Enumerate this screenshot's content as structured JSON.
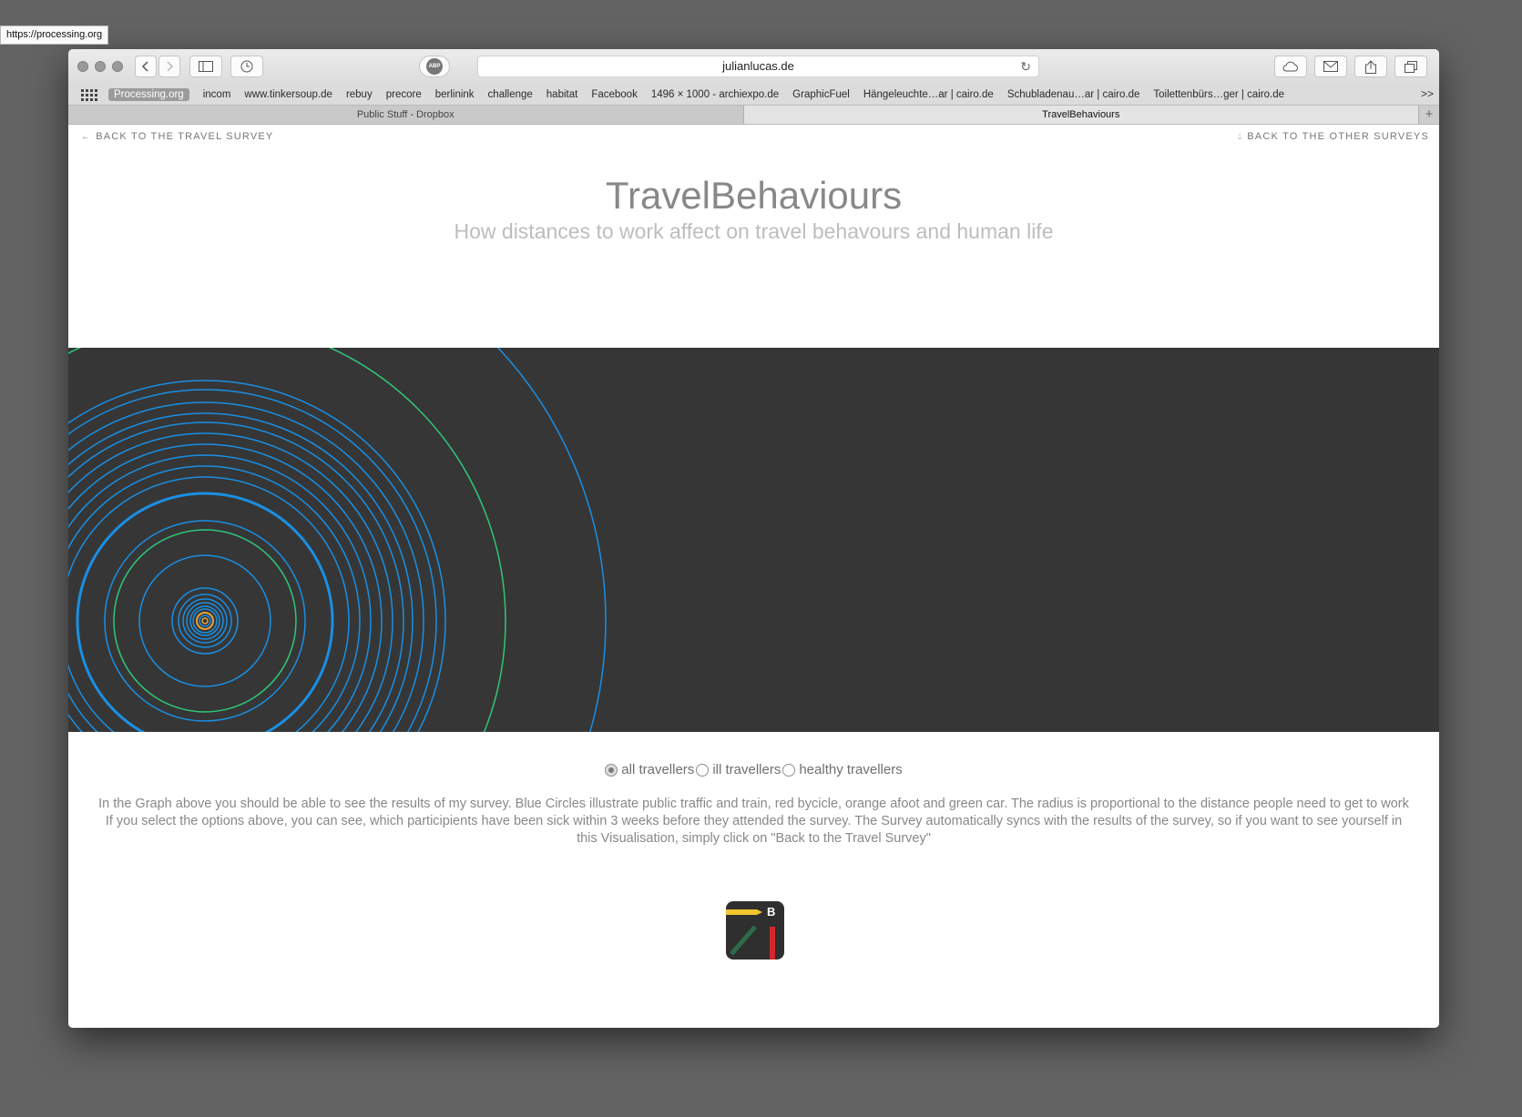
{
  "tooltip_url": "https://processing.org",
  "address_bar": {
    "host": "julianlucas.de"
  },
  "adblock_label": "ABP",
  "bookmarks": [
    "Processing.org",
    "incom",
    "www.tinkersoup.de",
    "rebuy",
    "precore",
    "berlinink",
    "challenge",
    "habitat",
    "Facebook",
    "1496 × 1000 - archiexpo.de",
    "GraphicFuel",
    "Hängeleuchte…ar | cairo.de",
    "Schubladenau…ar | cairo.de",
    "Toilettenbürs…ger | cairo.de"
  ],
  "bookmarks_more": ">>",
  "tabs": [
    {
      "label": "Public Stuff - Dropbox",
      "active": false
    },
    {
      "label": "TravelBehaviours",
      "active": true
    }
  ],
  "tab_add": "+",
  "nav": {
    "back_travel": "BACK TO THE TRAVEL SURVEY",
    "back_other": "BACK TO THE OTHER SURVEYS"
  },
  "header": {
    "title": "TravelBehaviours",
    "subtitle": "How distances to work affect on travel behavours and human life"
  },
  "colors": {
    "graph_bg": "#363636",
    "blue": "#1a8fe3",
    "green": "#2fc77a",
    "orange": "#e8a23a"
  },
  "filters": {
    "selected": "all travellers",
    "options": [
      "all travellers",
      "ill travellers",
      "healthy travellers"
    ]
  },
  "description": "In the Graph above you should be able to see the results of my survey. Blue Circles illustrate public traffic and train, red bycicle, orange afoot and green car. The radius is proportional to the distance people need to get to work If you select the options above, you can see, which participients have been sick within 3 weeks before they attended the survey. The Survey automatically syncs with the results of the survey, so if you want to see yourself in this Visualisation, simply click on \"Back to the Travel Survey\"",
  "logo_letter": "B"
}
